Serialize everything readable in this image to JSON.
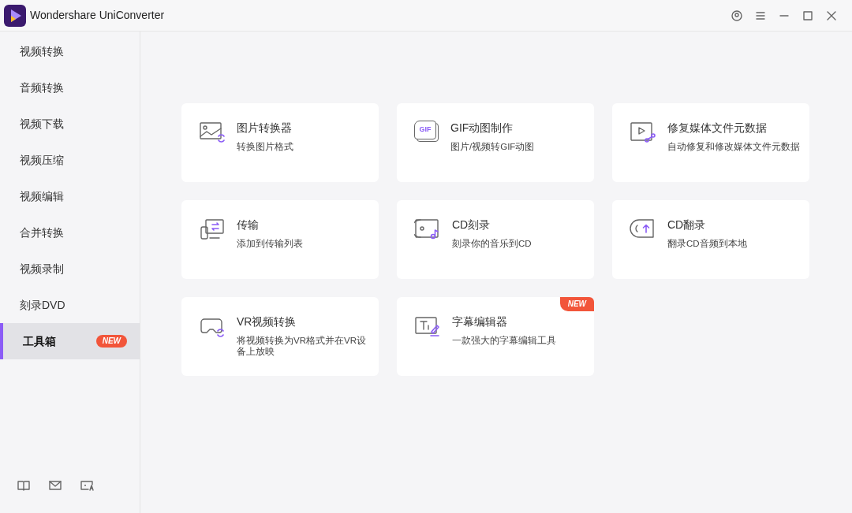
{
  "window": {
    "title": "Wondershare UniConverter"
  },
  "sidebar": {
    "items": [
      {
        "label": "视频转换",
        "selected": false
      },
      {
        "label": "音频转换",
        "selected": false
      },
      {
        "label": "视频下载",
        "selected": false
      },
      {
        "label": "视频压缩",
        "selected": false
      },
      {
        "label": "视频编辑",
        "selected": false
      },
      {
        "label": "合并转换",
        "selected": false
      },
      {
        "label": "视频录制",
        "selected": false
      },
      {
        "label": "刻录DVD",
        "selected": false
      },
      {
        "label": "工具箱",
        "selected": true,
        "badge": "NEW"
      }
    ]
  },
  "tools": [
    {
      "kind": "image",
      "title": "图片转换器",
      "description": "转换图片格式"
    },
    {
      "kind": "gif",
      "title": "GIF动图制作",
      "description": "图片/视频转GIF动图",
      "icon_text": "GIF"
    },
    {
      "kind": "repair",
      "title": "修复媒体文件元数据",
      "description": "自动修复和修改媒体文件元数据"
    },
    {
      "kind": "transfer",
      "title": "传输",
      "description": "添加到传输列表"
    },
    {
      "kind": "burn",
      "title": "CD刻录",
      "description": "刻录你的音乐到CD"
    },
    {
      "kind": "rip",
      "title": "CD翻录",
      "description": "翻录CD音频到本地"
    },
    {
      "kind": "vr",
      "title": "VR视频转换",
      "description": "将视频转换为VR格式并在VR设备上放映"
    },
    {
      "kind": "subtitle",
      "title": "字幕编辑器",
      "description": "一款强大的字幕编辑工具",
      "badge": "NEW"
    }
  ]
}
